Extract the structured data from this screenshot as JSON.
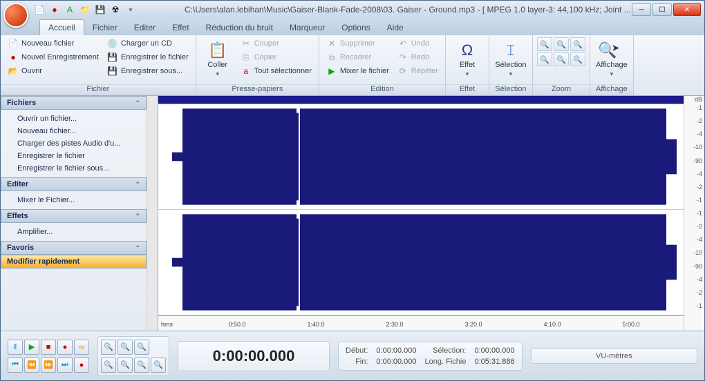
{
  "title": "C:\\Users\\alan.lebihan\\Music\\Gaiser-Blank-Fade-2008\\03. Gaiser - Ground.mp3 - [ MPEG 1.0 layer-3: 44,100 kHz; Joint ...",
  "tabs": [
    "Accueil",
    "Fichier",
    "Editer",
    "Effet",
    "Réduction du bruit",
    "Marqueur",
    "Options",
    "Aide"
  ],
  "ribbon": {
    "fichier": {
      "label": "Fichier",
      "nouveau": "Nouveau fichier",
      "nouvel": "Nouvel Enregistrement",
      "ouvrir": "Ouvrir",
      "charger": "Charger un CD",
      "enreg": "Enregistrer le fichier",
      "enregs": "Enregistrer sous..."
    },
    "presse": {
      "label": "Presse-papiers",
      "coller": "Coller",
      "couper": "Couper",
      "copier": "Copier",
      "tout": "Tout sélectionner"
    },
    "edition": {
      "label": "Edition",
      "supprimer": "Supprimer",
      "recadrer": "Recadrer",
      "mixer": "Mixer le fichier",
      "undo": "Undo",
      "redo": "Redo",
      "repeter": "Répéter"
    },
    "effet": "Effet",
    "selection": "Sélection",
    "zoom": "Zoom",
    "affichage": "Affichage"
  },
  "sidepanel": {
    "fichiers": {
      "label": "Fichiers",
      "items": [
        "Ouvrir un fichier...",
        "Nouveau fichier...",
        "Charger des pistes Audio d'u...",
        "Enregistrer le fichier",
        "Enregistrer le fichier sous..."
      ]
    },
    "editer": {
      "label": "Editer",
      "items": [
        "Mixer le Fichier..."
      ]
    },
    "effets": {
      "label": "Effets",
      "items": [
        "Amplifier..."
      ]
    },
    "favoris": {
      "label": "Favoris"
    },
    "modifier": {
      "label": "Modifier rapidement"
    }
  },
  "ruler": {
    "unit": "hms",
    "ticks": [
      "0:50.0",
      "1:40.0",
      "2:30.0",
      "3:20.0",
      "4:10.0",
      "5:00.0"
    ]
  },
  "db": {
    "top": "dB",
    "vals": [
      "-1",
      "-2",
      "-4",
      "-10",
      "-90",
      "-4",
      "-2",
      "-1"
    ]
  },
  "time": {
    "current": "0:00:00.000"
  },
  "info": {
    "debut_lbl": "Début:",
    "debut": "0:00:00.000",
    "fin_lbl": "Fin:",
    "fin": "0:00:00.000",
    "sel_lbl": "Sélection:",
    "sel": "0:00:00.000",
    "long_lbl": "Long. Fichie",
    "long": "0:05:31.886"
  },
  "vu": "VU-mètres"
}
